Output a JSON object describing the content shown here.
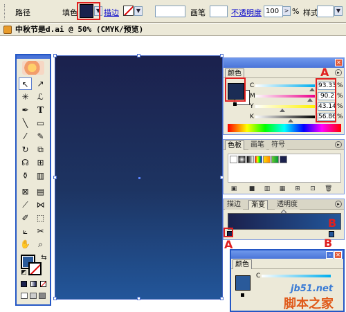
{
  "control_bar": {
    "path_label": "路径",
    "fill_label": "填色",
    "stroke_label": "描边",
    "brush_label": "画笔",
    "opacity_label": "不透明度",
    "opacity_value": "100",
    "opacity_unit": ">",
    "pct": "%",
    "style_label": "样式"
  },
  "document": {
    "title": "中秋节是d.ai @ 50% (CMYK/预览)"
  },
  "artboard": {
    "gradient_colors": [
      "#1b214d",
      "#22569a"
    ]
  },
  "color_panel": {
    "tab": "颜色",
    "channels": [
      {
        "label": "C",
        "value": "93.33",
        "pct": "%"
      },
      {
        "label": "M",
        "value": "90.2",
        "pct": "%"
      },
      {
        "label": "Y",
        "value": "43.14",
        "pct": "%"
      },
      {
        "label": "K",
        "value": "56.86",
        "pct": "%"
      }
    ],
    "fill_color": "#1b2c55"
  },
  "swatch_panel": {
    "tabs": [
      "色板",
      "画笔",
      "符号"
    ]
  },
  "gradient_panel": {
    "tabs": [
      "描边",
      "渐变",
      "透明度"
    ]
  },
  "color_panel_2": {
    "tab": "颜色",
    "channel_c_label": "C"
  },
  "annotations": {
    "letter_a": "A",
    "letter_b": "B"
  },
  "watermark": {
    "line1": "jb51.net",
    "line2": "脚本之家"
  },
  "icons": {
    "tools": [
      "selection-icon",
      "direct-selection-icon",
      "magic-wand-icon",
      "lasso-icon",
      "pen-icon",
      "type-icon",
      "line-icon",
      "rectangle-icon",
      "paintbrush-icon",
      "pencil-icon",
      "rotate-icon",
      "scale-icon",
      "warp-icon",
      "free-transform-icon",
      "symbol-sprayer-icon",
      "graph-icon",
      "mesh-icon",
      "gradient-icon",
      "eyedropper-icon",
      "blend-icon",
      "live-paint-icon",
      "live-paint-select-icon",
      "slice-icon",
      "scissors-icon",
      "hand-icon",
      "zoom-icon"
    ]
  }
}
